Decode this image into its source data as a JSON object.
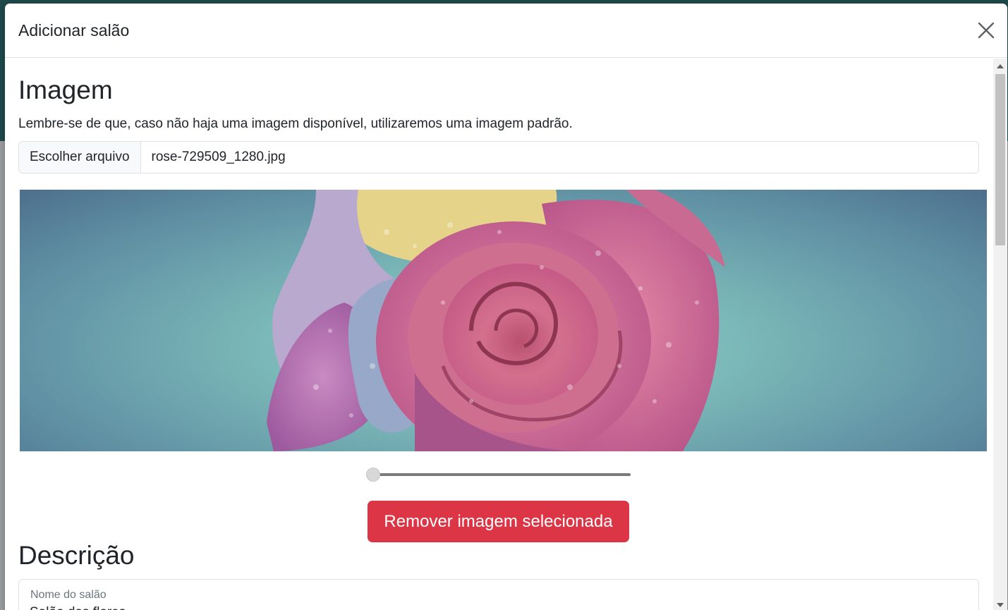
{
  "modal": {
    "title": "Adicionar salão"
  },
  "image_section": {
    "heading": "Imagem",
    "help_text": "Lembre-se de que, caso não haja uma imagem disponível, utilizaremos uma imagem padrão.",
    "file_button_label": "Escolher arquivo",
    "file_name": "rose-729509_1280.jpg",
    "zoom_level": 0,
    "remove_button_label": "Remover imagem selecionada"
  },
  "description_section": {
    "heading": "Descrição",
    "name_field": {
      "label": "Nome do salão",
      "value": "Salão das flores"
    }
  },
  "colors": {
    "danger": "#dc3545",
    "border": "#dee2e6",
    "text": "#212529",
    "muted": "#6c757d"
  },
  "icons": {
    "close": "close-icon"
  }
}
